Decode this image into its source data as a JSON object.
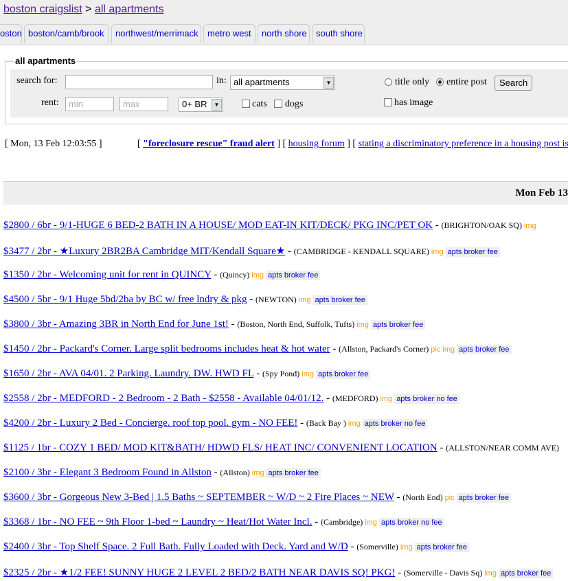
{
  "breadcrumb": {
    "site": "boston craigslist",
    "sep": ">",
    "section": "all apartments"
  },
  "tabs": [
    "oston",
    "boston/camb/brook",
    "northwest/merrimack",
    "metro west",
    "north shore",
    "south shore"
  ],
  "search": {
    "legend": "all apartments",
    "search_label": "search for:",
    "in_label": "in:",
    "in_value": "all apartments",
    "rent_label": "rent:",
    "min_placeholder": "min",
    "max_placeholder": "max",
    "br_value": "0+ BR",
    "cats": "cats",
    "dogs": "dogs",
    "title_only": "title only",
    "entire_post": "entire post",
    "button": "Search",
    "has_image": "has image"
  },
  "info": {
    "date": "[ Mon, 13 Feb 12:03:55 ]",
    "open1": "[ ",
    "fraud": "\"foreclosure rescue\" fraud alert",
    "mid1": " ] [ ",
    "forum": "housing forum",
    "mid2": " ] [ ",
    "discrim": "stating a discriminatory preference in a housing post is illegal"
  },
  "day_header": "Mon Feb 13",
  "listings": [
    {
      "title": "$2800 / 6br - 9/1-HUGE 6 BED-2 BATH IN A HOUSE/ MOD EAT-IN KIT/DECK/ PKG INC/PET OK",
      "loc": "(BRIGHTON/OAK SQ)",
      "tag": "img",
      "cat": ""
    },
    {
      "title": "$3477 / 2br - ★Luxury 2BR2BA Cambridge MIT/Kendall Square★",
      "loc": "(CAMBRIDGE - KENDALL SQUARE)",
      "tag": "img",
      "cat": "apts broker fee"
    },
    {
      "title": "$1350 / 2br - Welcoming unit for rent in QUINCY",
      "loc": "(Quincy)",
      "tag": "img",
      "cat": "apts broker fee"
    },
    {
      "title": "$4500 / 5br - 9/1 Huge 5bd/2ba by BC w/ free lndry & pkg",
      "loc": "(NEWTON)",
      "tag": "img",
      "cat": "apts broker fee"
    },
    {
      "title": "$3800 / 3br - Amazing 3BR in North End for June 1st!",
      "loc": "(Boston, North End, Suffolk, Tufts)",
      "tag": "img",
      "cat": "apts broker fee"
    },
    {
      "title": "$1450 / 2br - Packard's Corner. Large split bedrooms includes heat & hot water",
      "loc": "(Allston, Packard's Corner)",
      "tag": "pic img",
      "cat": "apts broker fee"
    },
    {
      "title": "$1650 / 2br - AVA 04/01. 2 Parking. Laundry. DW. HWD FL",
      "loc": "(Spy Pond)",
      "tag": "img",
      "cat": "apts broker fee"
    },
    {
      "title": "$2558 / 2br - MEDFORD - 2 Bedroom - 2 Bath - $2558 - Available 04/01/12.",
      "loc": "(MEDFORD)",
      "tag": "img",
      "cat": "apts broker no fee"
    },
    {
      "title": "$4200 / 2br - Luxury 2 Bed - Concierge. roof top pool. gym - NO FEE!",
      "loc": "(Back Bay )",
      "tag": "img",
      "cat": "apts broker no fee"
    },
    {
      "title": "$1125 / 1br - COZY 1 BED/ MOD KIT&BATH/ HDWD FLS/ HEAT INC/ CONVENIENT LOCATION",
      "loc": "(ALLSTON/NEAR COMM AVE)",
      "tag": "",
      "cat": ""
    },
    {
      "title": "$2100 / 3br - Elegant 3 Bedroom Found in Allston",
      "loc": "(Allston)",
      "tag": "img",
      "cat": "apts broker fee"
    },
    {
      "title": "$3600 / 3br - Gorgeous New 3-Bed | 1.5 Baths ~ SEPTEMBER ~ W/D ~ 2 Fire Places ~ NEW",
      "loc": "(North End)",
      "tag": "pic",
      "cat": "apts broker fee"
    },
    {
      "title": "$3368 / 1br - NO FEE ~ 9th Floor 1-bed ~ Laundry ~ Heat/Hot Water Incl.",
      "loc": "(Cambridge)",
      "tag": "img",
      "cat": "apts broker no fee"
    },
    {
      "title": "$2400 / 3br - Top Shelf Space. 2 Full Bath. Fully Loaded with Deck. Yard and W/D",
      "loc": "(Somerville)",
      "tag": "img",
      "cat": "apts broker fee"
    },
    {
      "title": "$2325 / 2br - ★1/2 FEE! SUNNY HUGE 2 LEVEL 2 BED/2 BATH NEAR DAVIS SQ! PKG!",
      "loc": "(Somerville - Davis Sq)",
      "tag": "img",
      "cat": "apts broker fee"
    }
  ],
  "colors": {
    "link": "#0000cc",
    "visited": "#551a8b",
    "img_tag": "#ff9900",
    "panel": "#eeeeee"
  }
}
